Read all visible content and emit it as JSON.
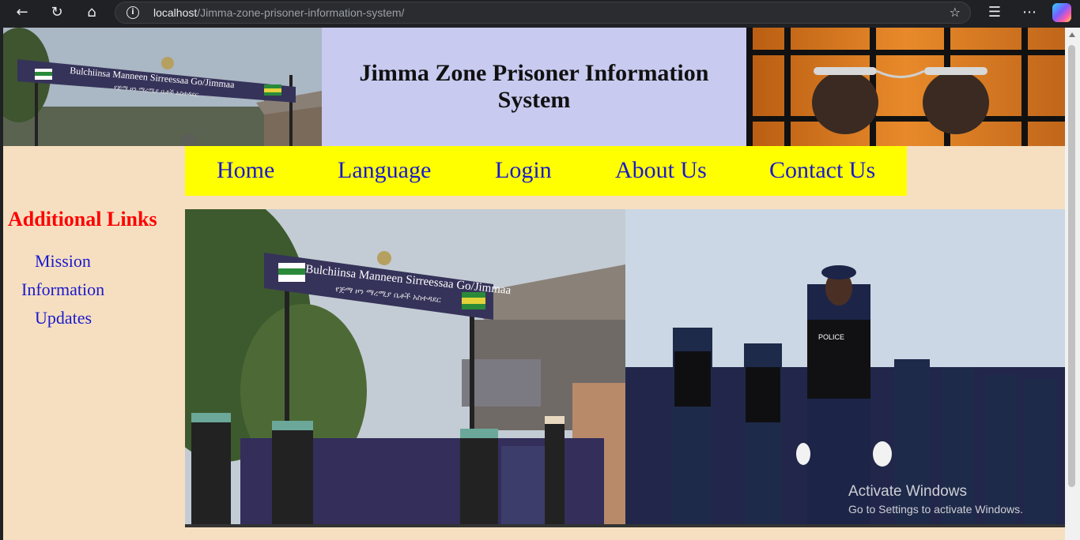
{
  "browser": {
    "url_host": "localhost",
    "url_path": "/Jimma-zone-prisoner-information-system/"
  },
  "header": {
    "title": "Jimma Zone Prisoner Information System",
    "gate_sign_line1": "Bulchiinsa Manneen Sirreessaa Go/Jimmaa",
    "gate_sign_line2": "የጅማ ዞን ማረሚያ ቤቶች አስተዳደር",
    "title_bg": "#c8caf0"
  },
  "nav": {
    "items": [
      "Home",
      "Language",
      "Login",
      "About Us",
      "Contact Us"
    ],
    "bg": "#ffff00",
    "link_color": "#1a1acc"
  },
  "sidebar": {
    "title": "Additional Links",
    "links": [
      "Mission",
      "Information",
      "Updates"
    ],
    "title_color": "#ff0000"
  },
  "main": {
    "gate_sign_line1": "Bulchiinsa Manneen Sirreessaa Go/Jimmaa",
    "gate_sign_line2": "የጅማ ዞን ማረሚያ ቤቶች አስተዳደር",
    "police_vest_label": "POLICE"
  },
  "os_watermark": {
    "line1": "Activate Windows",
    "line2": "Go to Settings to activate Windows."
  },
  "page_bg": "#f6dfc0"
}
